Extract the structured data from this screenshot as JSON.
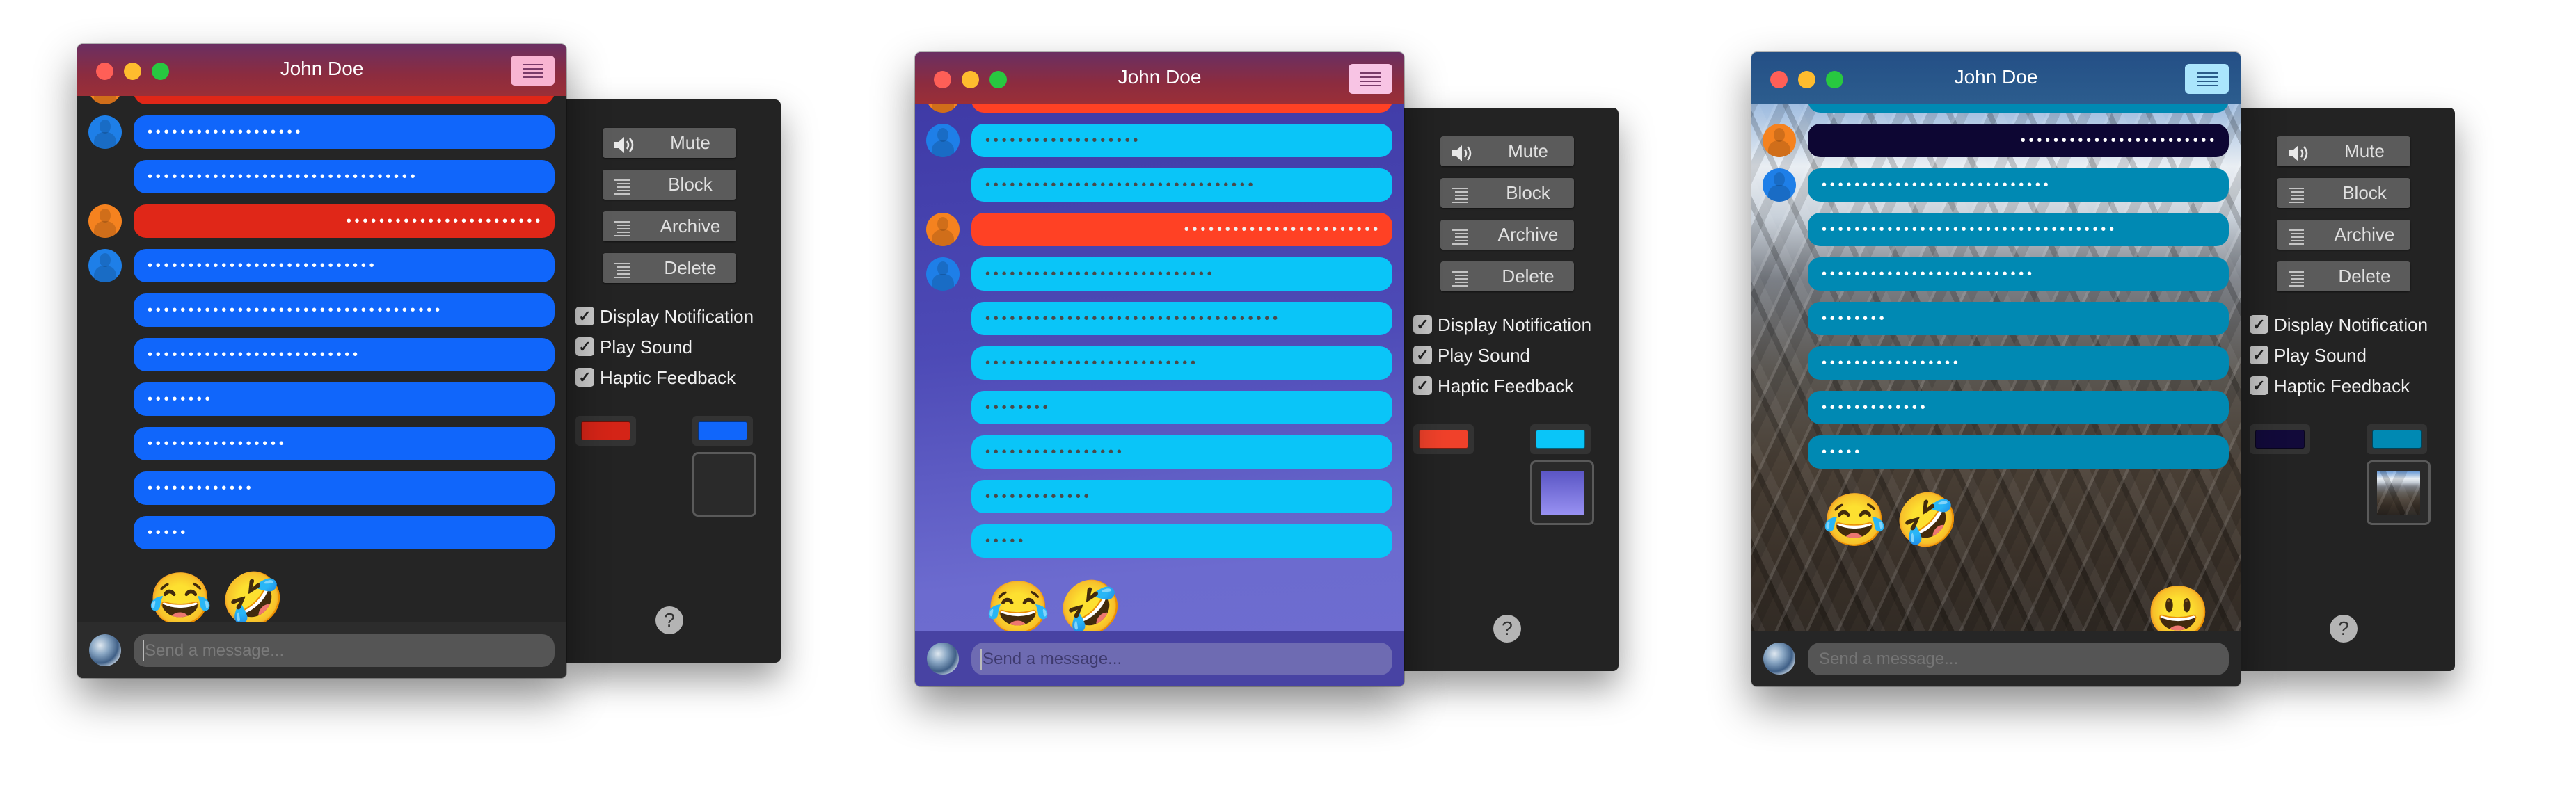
{
  "windows": [
    {
      "title": "John Doe",
      "theme": {
        "background": "dark",
        "background_color": "#252525",
        "titlebar": "#8c2c3f",
        "menu_button": "#f8b4d2",
        "menu_lines": "#7a3b6a",
        "incoming_bubble": "#1066fb",
        "incoming_text": "#ffffff",
        "outgoing_bubble": "#e02718",
        "outgoing_text": "#ffffff",
        "input_bar": "#2c2c2c",
        "input_field": "#555555",
        "placeholder_color": "#7a7a7a"
      },
      "messages": [
        {
          "from": "outgoing",
          "avatar": "orange",
          "text": ""
        },
        {
          "from": "incoming",
          "avatar": "blue",
          "text": "•••••••••••••••••••"
        },
        {
          "from": "incoming",
          "avatar": null,
          "text": "•••••••••••••••••••••••••••••••••"
        },
        {
          "from": "outgoing",
          "avatar": "orange",
          "text": "••••••••••••••••••••••••"
        },
        {
          "from": "incoming",
          "avatar": "blue",
          "text": "••••••••••••••••••••••••••••"
        },
        {
          "from": "incoming",
          "avatar": null,
          "text": "••••••••••••••••••••••••••••••••••••"
        },
        {
          "from": "incoming",
          "avatar": null,
          "text": "••••••••••••••••••••••••••"
        },
        {
          "from": "incoming",
          "avatar": null,
          "text": "••••••••"
        },
        {
          "from": "incoming",
          "avatar": null,
          "text": "•••••••••••••••••"
        },
        {
          "from": "incoming",
          "avatar": null,
          "text": "•••••••••••••"
        },
        {
          "from": "incoming",
          "avatar": null,
          "text": "•••••"
        }
      ],
      "emojis": [
        "😂",
        "🤣"
      ],
      "extra_emoji": null,
      "input_placeholder": "Send a message...",
      "panel": {
        "buttons": [
          {
            "label": "Mute",
            "icon": "speaker-icon"
          },
          {
            "label": "Block",
            "icon": "list-icon"
          },
          {
            "label": "Archive",
            "icon": "list-icon"
          },
          {
            "label": "Delete",
            "icon": "list-icon"
          }
        ],
        "checkboxes": [
          {
            "label": "Display Notification",
            "checked": true
          },
          {
            "label": "Play Sound",
            "checked": true
          },
          {
            "label": "Haptic Feedback",
            "checked": true
          }
        ],
        "outgoing_color": "#d42417",
        "incoming_color": "#1066fb",
        "background_well": "empty",
        "help_label": "?"
      }
    },
    {
      "title": "John Doe",
      "theme": {
        "background": "purple-gradient",
        "background_color": "#5a55bf",
        "titlebar": "#8c2c3f",
        "menu_button": "#f8c4e4",
        "menu_lines": "#7a3b6a",
        "incoming_bubble": "#0ac5f8",
        "incoming_text": "#4a4a4a",
        "outgoing_bubble": "#ff4124",
        "outgoing_text": "#f0f0f0",
        "input_bar": "#4843a3",
        "input_field": "#6e6bb2",
        "placeholder_color": "#3e3a6e"
      },
      "messages": [
        {
          "from": "outgoing",
          "avatar": "orange",
          "text": ""
        },
        {
          "from": "incoming",
          "avatar": "blue",
          "text": "•••••••••••••••••••"
        },
        {
          "from": "incoming",
          "avatar": null,
          "text": "•••••••••••••••••••••••••••••••••"
        },
        {
          "from": "outgoing",
          "avatar": "orange",
          "text": "••••••••••••••••••••••••"
        },
        {
          "from": "incoming",
          "avatar": "blue",
          "text": "••••••••••••••••••••••••••••"
        },
        {
          "from": "incoming",
          "avatar": null,
          "text": "••••••••••••••••••••••••••••••••••••"
        },
        {
          "from": "incoming",
          "avatar": null,
          "text": "••••••••••••••••••••••••••"
        },
        {
          "from": "incoming",
          "avatar": null,
          "text": "••••••••"
        },
        {
          "from": "incoming",
          "avatar": null,
          "text": "•••••••••••••••••"
        },
        {
          "from": "incoming",
          "avatar": null,
          "text": "•••••••••••••"
        },
        {
          "from": "incoming",
          "avatar": null,
          "text": "•••••"
        }
      ],
      "emojis": [
        "😂",
        "🤣"
      ],
      "extra_emoji": null,
      "input_placeholder": "Send a message...",
      "panel": {
        "buttons": [
          {
            "label": "Mute",
            "icon": "speaker-icon"
          },
          {
            "label": "Block",
            "icon": "list-icon"
          },
          {
            "label": "Archive",
            "icon": "list-icon"
          },
          {
            "label": "Delete",
            "icon": "list-icon"
          }
        ],
        "checkboxes": [
          {
            "label": "Display Notification",
            "checked": true
          },
          {
            "label": "Play Sound",
            "checked": true
          },
          {
            "label": "Haptic Feedback",
            "checked": true
          }
        ],
        "outgoing_color": "#f0412a",
        "incoming_color": "#0ac5f8",
        "background_well": "gradient",
        "help_label": "?"
      }
    },
    {
      "title": "John Doe",
      "theme": {
        "background": "mountain-photo",
        "background_color": "#4a4036",
        "titlebar": "#2c5d8e",
        "menu_button": "#aae5fc",
        "menu_lines": "#2a5c8a",
        "incoming_bubble": "#0089b3",
        "incoming_text": "#ffffff",
        "outgoing_bubble": "#0d0633",
        "outgoing_text": "#ffffff",
        "input_bar": "#262626",
        "input_field": "#555555",
        "placeholder_color": "#757575"
      },
      "messages": [
        {
          "from": "incoming",
          "avatar": null,
          "text": ""
        },
        {
          "from": "outgoing",
          "avatar": "orange",
          "text": "••••••••••••••••••••••••"
        },
        {
          "from": "incoming",
          "avatar": "blue",
          "text": "••••••••••••••••••••••••••••"
        },
        {
          "from": "incoming",
          "avatar": null,
          "text": "••••••••••••••••••••••••••••••••••••"
        },
        {
          "from": "incoming",
          "avatar": null,
          "text": "••••••••••••••••••••••••••"
        },
        {
          "from": "incoming",
          "avatar": null,
          "text": "••••••••"
        },
        {
          "from": "incoming",
          "avatar": null,
          "text": "•••••••••••••••••"
        },
        {
          "from": "incoming",
          "avatar": null,
          "text": "•••••••••••••"
        },
        {
          "from": "incoming",
          "avatar": null,
          "text": "•••••"
        }
      ],
      "emojis": [
        "😂",
        "🤣"
      ],
      "extra_emoji": "😃",
      "input_placeholder": "Send a message...",
      "panel": {
        "buttons": [
          {
            "label": "Mute",
            "icon": "speaker-icon"
          },
          {
            "label": "Block",
            "icon": "list-icon"
          },
          {
            "label": "Archive",
            "icon": "list-icon"
          },
          {
            "label": "Delete",
            "icon": "list-icon"
          }
        ],
        "checkboxes": [
          {
            "label": "Display Notification",
            "checked": true
          },
          {
            "label": "Play Sound",
            "checked": true
          },
          {
            "label": "Haptic Feedback",
            "checked": true
          }
        ],
        "outgoing_color": "#120a3a",
        "incoming_color": "#0089b3",
        "background_well": "image",
        "help_label": "?"
      }
    }
  ],
  "traffic_lights": {
    "close": "#ff5f57",
    "minimize": "#febc2e",
    "zoom": "#28c840"
  },
  "avatar_colors": {
    "orange": "#f5821f",
    "blue": "#1e7fe8"
  },
  "checkmark": "✓"
}
